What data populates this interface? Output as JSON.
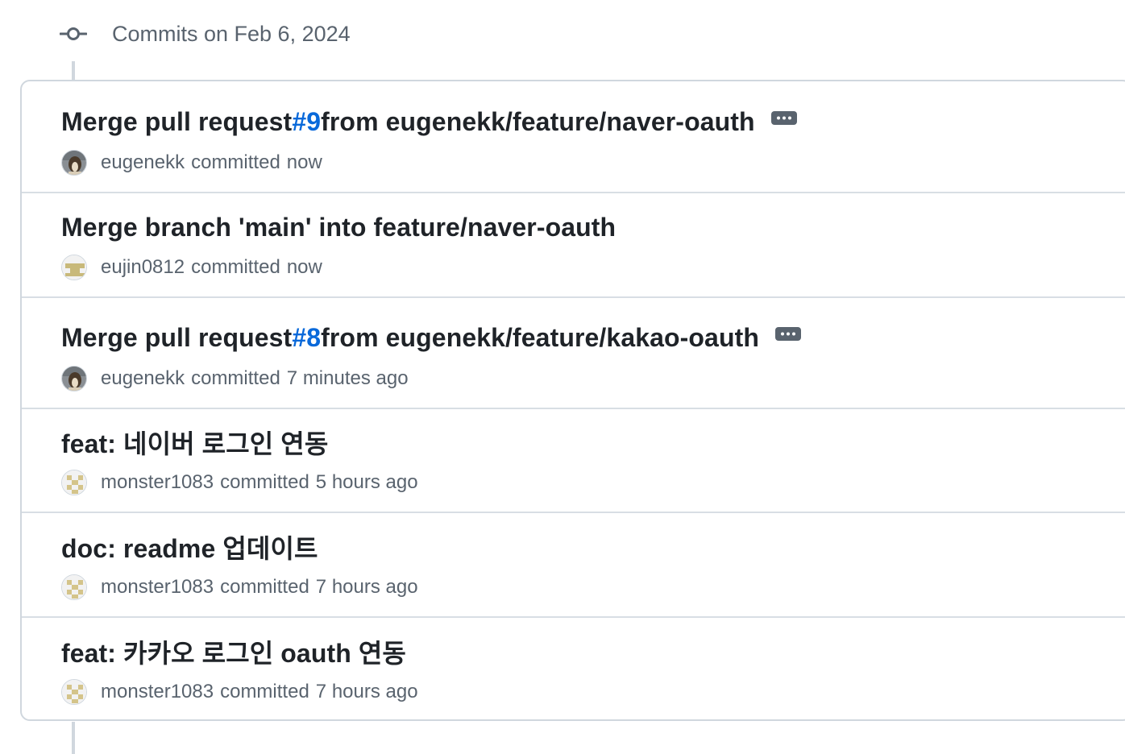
{
  "group": {
    "title": "Commits on Feb 6, 2024",
    "icon": "git-commit-icon"
  },
  "colors": {
    "link": "#0969da",
    "text": "#1f2328",
    "muted": "#59636e",
    "border": "#d0d7de"
  },
  "commits": [
    {
      "title_prefix": "Merge pull request ",
      "pr": "#9",
      "title_suffix": " from eugenekk/feature/naver-oauth",
      "author": "eugenekk",
      "action": "committed",
      "time": "now",
      "avatar": "photo-avatar",
      "has_expand": true
    },
    {
      "title": "Merge branch 'main' into feature/naver-oauth",
      "author": "eujin0812",
      "action": "committed",
      "time": "now",
      "avatar": "identicon-avatar"
    },
    {
      "title_prefix": "Merge pull request ",
      "pr": "#8",
      "title_suffix": " from eugenekk/feature/kakao-oauth",
      "author": "eugenekk",
      "action": "committed",
      "time": "7 minutes ago",
      "avatar": "photo-avatar",
      "has_expand": true
    },
    {
      "title": "feat: 네이버 로그인 연동",
      "author": "monster1083",
      "action": "committed",
      "time": "5 hours ago",
      "avatar": "identicon-avatar"
    },
    {
      "title": "doc: readme 업데이트",
      "author": "monster1083",
      "action": "committed",
      "time": "7 hours ago",
      "avatar": "identicon-avatar"
    },
    {
      "title": "feat: 카카오 로그인 oauth 연동",
      "author": "monster1083",
      "action": "committed",
      "time": "7 hours ago",
      "avatar": "identicon-avatar"
    }
  ]
}
